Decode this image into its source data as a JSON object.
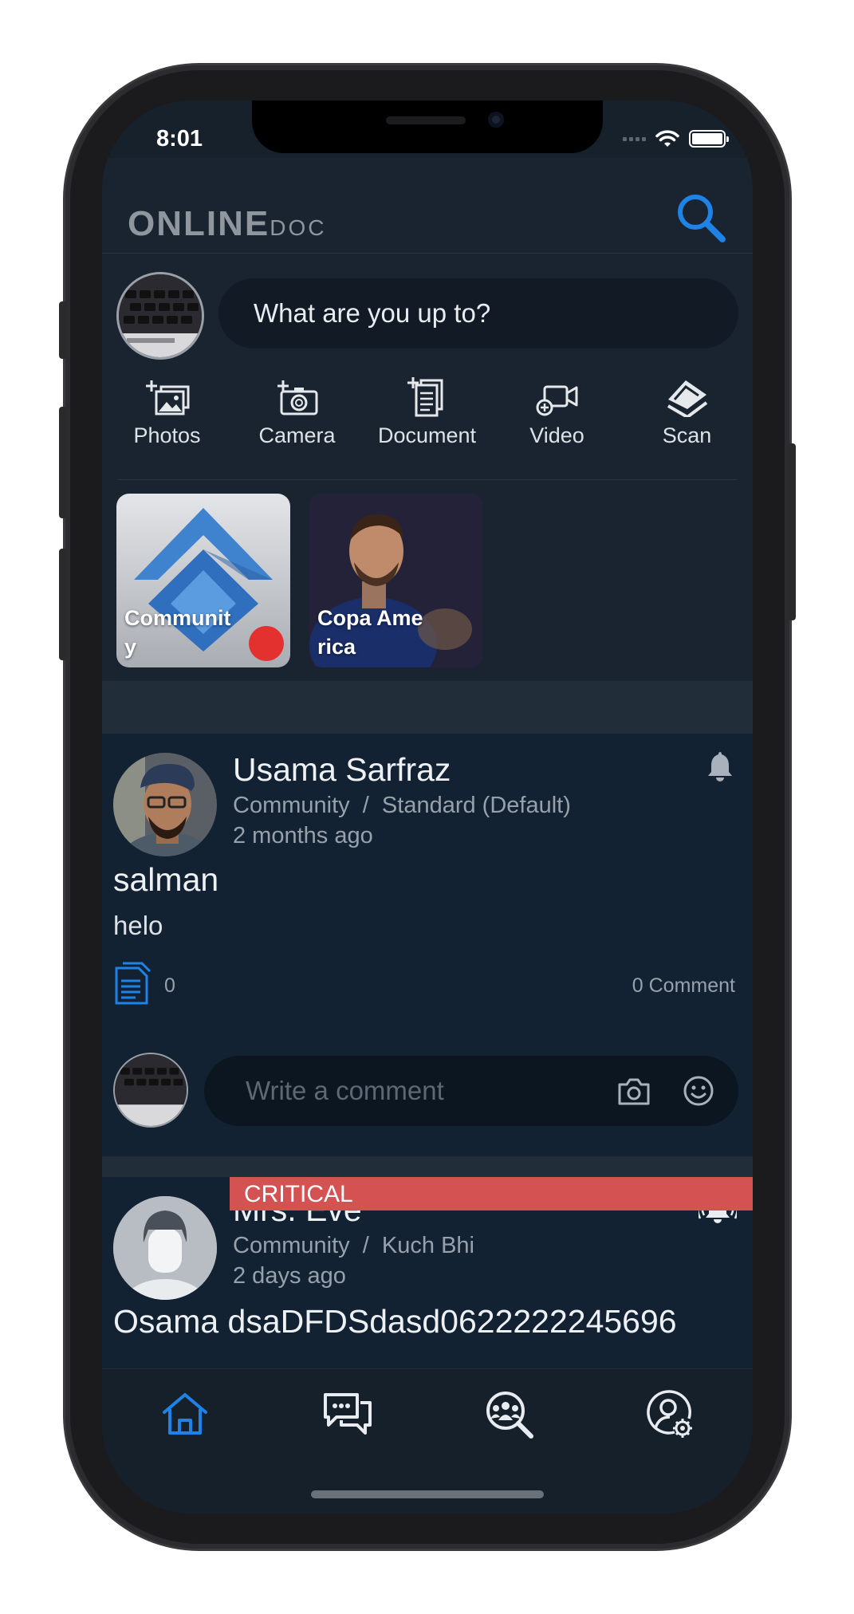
{
  "status_bar": {
    "time": "8:01"
  },
  "header": {
    "logo_main": "ONLINE",
    "logo_sub": "DOC"
  },
  "composer": {
    "placeholder": "What are you up to?",
    "actions": [
      {
        "label": "Photos",
        "icon": "add-photo-icon"
      },
      {
        "label": "Camera",
        "icon": "add-camera-icon"
      },
      {
        "label": "Document",
        "icon": "add-document-icon"
      },
      {
        "label": "Video",
        "icon": "add-video-icon"
      },
      {
        "label": "Scan",
        "icon": "scan-icon"
      }
    ]
  },
  "stories": [
    {
      "label": "Community",
      "live": true
    },
    {
      "label": "Copa America",
      "live": false
    }
  ],
  "posts": [
    {
      "author": "Usama Sarfraz",
      "community": "Community  /  Standard (Default)",
      "time": "2 months ago",
      "title": "salman",
      "body": "helo",
      "attachments": "0",
      "comments": "0 Comment",
      "comment_placeholder": "Write a comment"
    },
    {
      "badge": "CRITICAL",
      "author": "Mrs. Eve",
      "community": "Community  /  Kuch Bhi",
      "time": "2 days ago",
      "title": "Osama dsaDFDSdasd0622222245696"
    }
  ],
  "tabbar": [
    "home-icon",
    "chat-icon",
    "find-people-icon",
    "profile-settings-icon"
  ],
  "colors": {
    "accent": "#1e82e6",
    "critical": "#d55252",
    "background": "#16212c"
  }
}
